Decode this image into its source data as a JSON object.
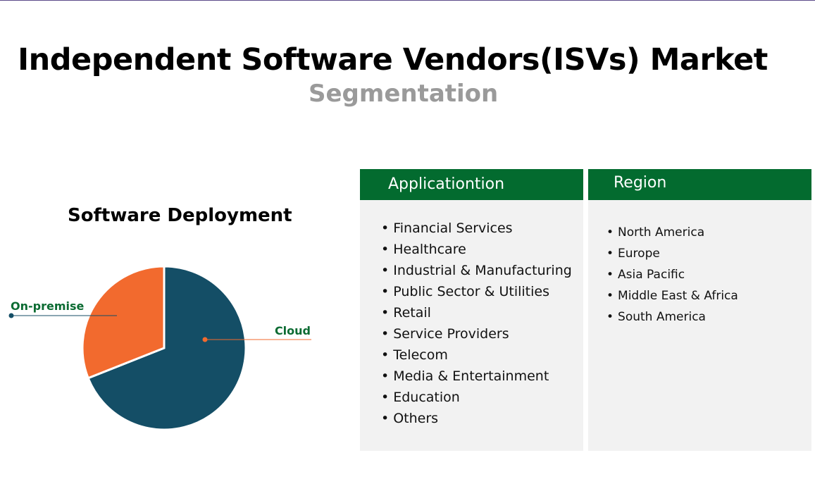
{
  "title": "Independent Software Vendors(ISVs) Market",
  "subtitle": "Segmentation",
  "chart_data": {
    "type": "pie",
    "title": "Software Deployment",
    "categories": [
      "Cloud",
      "On-premise"
    ],
    "values": [
      69,
      31
    ],
    "colors": {
      "Cloud": "#144e66",
      "On-premise": "#f26a2e"
    }
  },
  "application": {
    "header": "Applicationtion",
    "items": [
      "Financial Services",
      "Healthcare",
      "Industrial & Manufacturing",
      "Public Sector & Utilities",
      "Retail",
      "Service Providers",
      "Telecom",
      "Media & Entertainment",
      "Education",
      "Others"
    ]
  },
  "region": {
    "header": "Region",
    "items": [
      "North America",
      "Europe",
      "Asia Pacific",
      "Middle East & Africa",
      "South America"
    ]
  }
}
